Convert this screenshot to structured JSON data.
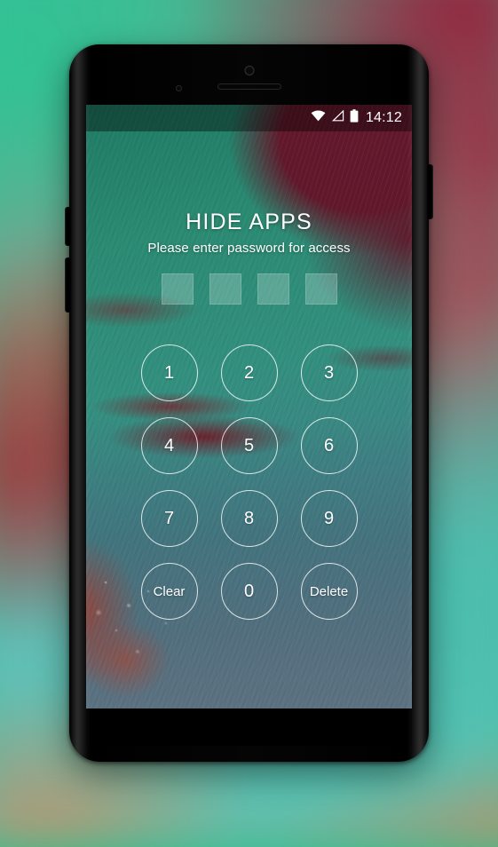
{
  "status_bar": {
    "icons": [
      "wifi-icon",
      "signal-icon",
      "battery-icon"
    ],
    "clock": "14:12"
  },
  "lock_screen": {
    "title": "HIDE APPS",
    "subtitle": "Please enter password for access",
    "password_field": {
      "slots": 4,
      "entered": 0,
      "boxes": [
        "",
        "",
        "",
        ""
      ]
    },
    "keypad": [
      {
        "label": "1",
        "name": "key-1",
        "type": "digit"
      },
      {
        "label": "2",
        "name": "key-2",
        "type": "digit"
      },
      {
        "label": "3",
        "name": "key-3",
        "type": "digit"
      },
      {
        "label": "4",
        "name": "key-4",
        "type": "digit"
      },
      {
        "label": "5",
        "name": "key-5",
        "type": "digit"
      },
      {
        "label": "6",
        "name": "key-6",
        "type": "digit"
      },
      {
        "label": "7",
        "name": "key-7",
        "type": "digit"
      },
      {
        "label": "8",
        "name": "key-8",
        "type": "digit"
      },
      {
        "label": "9",
        "name": "key-9",
        "type": "digit"
      },
      {
        "label": "Clear",
        "name": "key-clear",
        "type": "action"
      },
      {
        "label": "0",
        "name": "key-0",
        "type": "digit"
      },
      {
        "label": "Delete",
        "name": "key-delete",
        "type": "action"
      }
    ]
  },
  "device": {
    "hardware": [
      "front-camera",
      "earpiece-speaker",
      "proximity-sensor",
      "volume-up-key",
      "volume-down-key",
      "power-key"
    ]
  },
  "colors": {
    "key_stroke": "#ffffff",
    "text": "#ffffff",
    "status_scrim": "#000000",
    "wallpaper_teal": "#2a8a72",
    "wallpaper_maroon": "#61182b",
    "wallpaper_slate": "#5b7f8e",
    "bezel": "#000000"
  }
}
